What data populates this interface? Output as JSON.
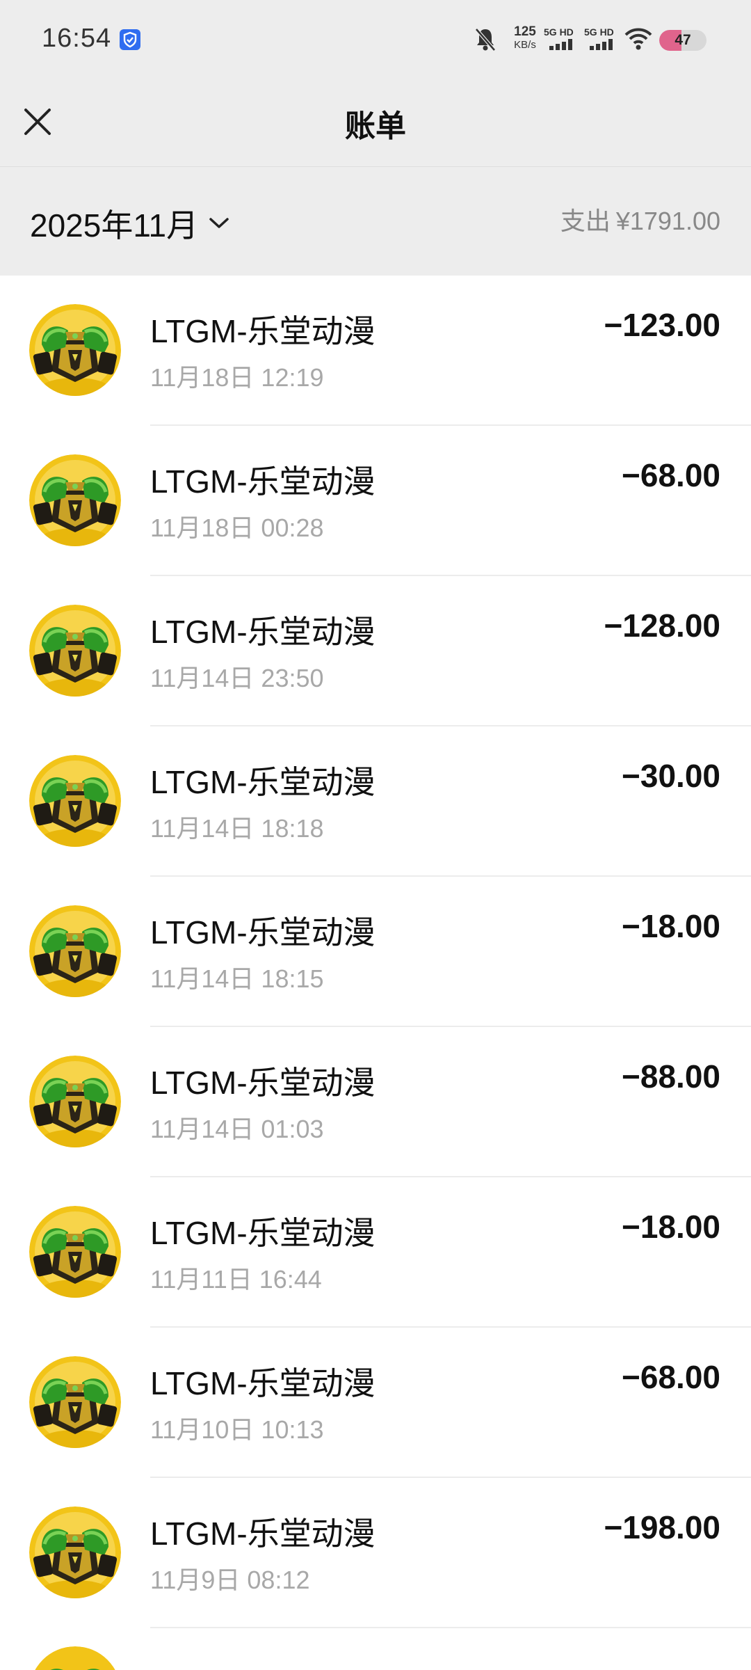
{
  "status_bar": {
    "time": "16:54",
    "net_speed_value": "125",
    "net_speed_unit": "KB/s",
    "sim1_label": "5G HD",
    "sim2_label": "5G HD",
    "battery_level": "47",
    "battery_fraction": 0.47
  },
  "nav": {
    "title": "账单"
  },
  "filter": {
    "month": "2025年11月",
    "summary_label": "支出",
    "summary_amount": "¥1791.00"
  },
  "transactions": [
    {
      "merchant": "LTGM-乐堂动漫",
      "datetime": "11月18日 12:19",
      "amount": "−123.00"
    },
    {
      "merchant": "LTGM-乐堂动漫",
      "datetime": "11月18日 00:28",
      "amount": "−68.00"
    },
    {
      "merchant": "LTGM-乐堂动漫",
      "datetime": "11月14日 23:50",
      "amount": "−128.00"
    },
    {
      "merchant": "LTGM-乐堂动漫",
      "datetime": "11月14日 18:18",
      "amount": "−30.00"
    },
    {
      "merchant": "LTGM-乐堂动漫",
      "datetime": "11月14日 18:15",
      "amount": "−18.00"
    },
    {
      "merchant": "LTGM-乐堂动漫",
      "datetime": "11月14日 01:03",
      "amount": "−88.00"
    },
    {
      "merchant": "LTGM-乐堂动漫",
      "datetime": "11月11日 16:44",
      "amount": "−18.00"
    },
    {
      "merchant": "LTGM-乐堂动漫",
      "datetime": "11月10日 10:13",
      "amount": "−68.00"
    },
    {
      "merchant": "LTGM-乐堂动漫",
      "datetime": "11月9日 08:12",
      "amount": "−198.00"
    }
  ],
  "colors": {
    "header_bg": "#ededed",
    "list_bg": "#ffffff",
    "battery_fill": "#e0648c",
    "avatar_gold": "#f2c418",
    "avatar_green": "#2f9a28"
  }
}
